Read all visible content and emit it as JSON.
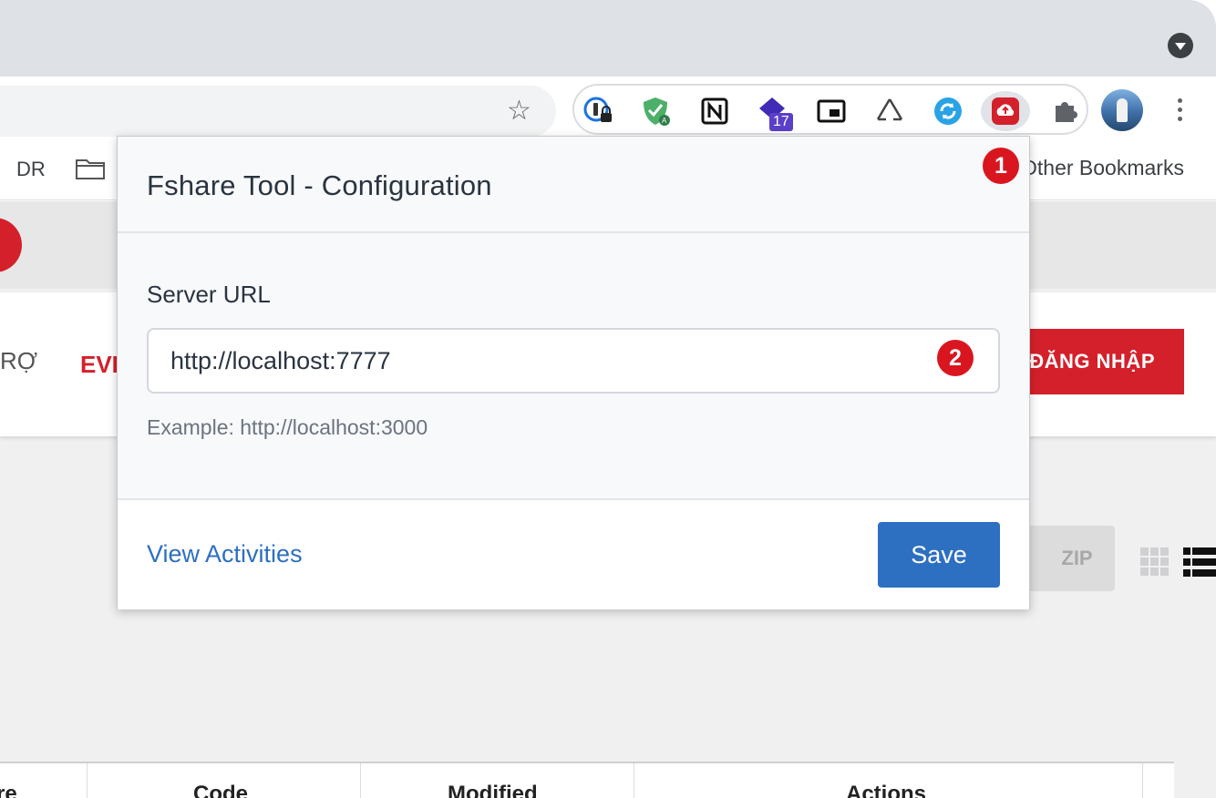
{
  "browser": {
    "bookmarks": {
      "dr_label": "DR",
      "other_label": "Other Bookmarks"
    },
    "extensions": [
      {
        "icon": "1password-icon"
      },
      {
        "icon": "adguard-shield-icon"
      },
      {
        "icon": "notion-icon"
      },
      {
        "icon": "purple-diamond-icon",
        "badge": "17"
      },
      {
        "icon": "picture-in-picture-icon"
      },
      {
        "icon": "recycle-icon"
      },
      {
        "icon": "sync-icon"
      },
      {
        "icon": "fshare-cloud-icon"
      },
      {
        "icon": "extensions-puzzle-icon"
      }
    ]
  },
  "page": {
    "nav_tro": "RỢ",
    "nav_evi": "EVI",
    "login_label": "ĐĂNG NHẬP",
    "zip_label": "ZIP",
    "table_headers": [
      "re",
      "Code",
      "Modified",
      "Actions"
    ]
  },
  "popup": {
    "title": "Fshare Tool - Configuration",
    "server_url_label": "Server URL",
    "server_url_value": "http://localhost:7777",
    "server_url_help": "Example: http://localhost:3000",
    "view_activities_label": "View Activities",
    "save_label": "Save"
  },
  "markers": [
    "1",
    "2"
  ],
  "colors": {
    "accent": "#2d6fc1",
    "brand_red": "#d4202a",
    "marker_red": "#d9161f"
  }
}
